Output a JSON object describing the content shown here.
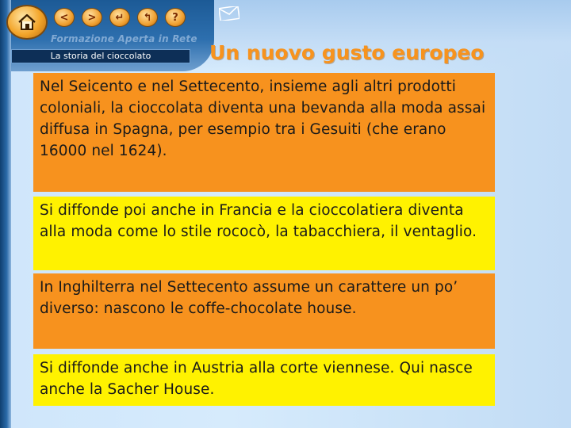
{
  "header": {
    "brand": "Formazione Aperta in Rete",
    "breadcrumb": "La storia del cioccolato",
    "title": "Un nuovo gusto europeo",
    "nav": {
      "back_label": "<",
      "forward_label": ">",
      "return_label": "↵",
      "up_label": "↰",
      "help_label": "?"
    }
  },
  "content": {
    "blocks": [
      "Nel Seicento e nel Settecento, insieme agli altri prodotti coloniali, la cioccolata diventa una bevanda alla moda assai diffusa in Spagna, per esempio tra i Gesuiti (che erano 16000 nel 1624).",
      "Si diffonde poi anche in Francia e la cioccolatiera diventa alla moda come lo stile rococò, la tabacchiera, il ventaglio.",
      "In Inghilterra nel Settecento assume un carattere un po’ diverso: nascono le coffe-chocolate house.",
      "Si diffonde anche in Austria alla corte viennese. Qui nasce anche la Sacher House."
    ]
  },
  "colors": {
    "orange_box": "#f7921e",
    "yellow_box": "#fff200",
    "title": "#f7931e",
    "breadcrumb_bg": "#0d2f57"
  },
  "icons": {
    "home": "home-icon",
    "mail": "mail-icon"
  }
}
